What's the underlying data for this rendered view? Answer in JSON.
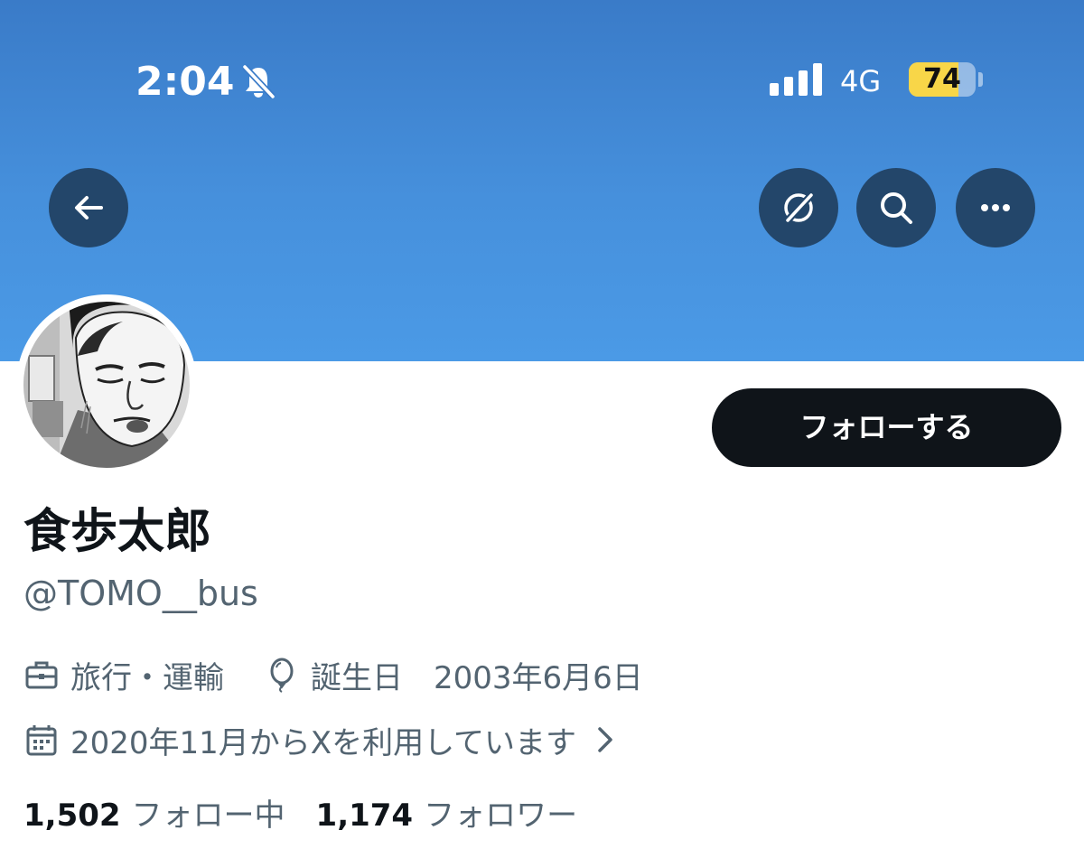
{
  "status_bar": {
    "time": "2:04",
    "network": "4G",
    "battery": "74",
    "battery_level": 0.74,
    "icons": [
      "bell-slash-icon",
      "signal-bars-icon",
      "battery-icon"
    ]
  },
  "banner": {
    "color_top": "#3a7bc8",
    "color_bottom": "#4b9ae6",
    "buttons": [
      "back-arrow-icon",
      "grok-icon",
      "search-icon",
      "more-dots-icon"
    ]
  },
  "profile": {
    "display_name": "食歩太郎",
    "handle": "@TOMO__bus",
    "follow_label": "フォローする",
    "category": "旅行・運輸",
    "birthday": "誕生日　2003年6月6日",
    "joined": "2020年11月からXを利用しています",
    "following_count": "1,502",
    "following_label": "フォロー中",
    "followers_count": "1,174",
    "followers_label": "フォロワー"
  },
  "colors": {
    "text_primary": "#0f1419",
    "text_secondary": "#536471",
    "button_dark": "#0f1419",
    "icon_button_bg": "#23466a",
    "battery_yellow": "#f8d648"
  }
}
